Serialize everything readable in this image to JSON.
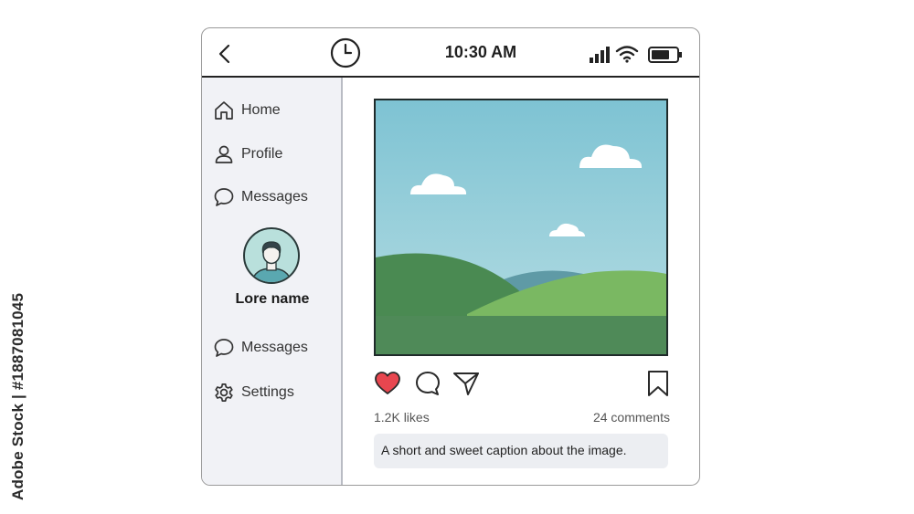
{
  "side_caption": "Adobe Stock | #1887081045",
  "status_bar": {
    "time": "10:30 AM",
    "icons": [
      "back-arrow-icon",
      "clock-icon",
      "signal-icon",
      "wifi-icon",
      "battery-icon"
    ]
  },
  "sidebar": {
    "items_top": [
      {
        "label": "Home",
        "icon": "home-icon"
      },
      {
        "label": "Profile",
        "icon": "user-icon"
      },
      {
        "label": "Messages",
        "icon": "chat-bubble-icon"
      }
    ],
    "profile": {
      "name": "Lore name",
      "avatar": "avatar-icon"
    },
    "items_bottom": [
      {
        "label": "Messages",
        "icon": "chat-bubble-icon"
      },
      {
        "label": "Settings",
        "icon": "gear-icon"
      }
    ]
  },
  "post": {
    "image": "landscape-illustration",
    "likes": "1.2K likes",
    "comments": "24 comments",
    "caption": "A short and sweet caption about the image.",
    "actions": [
      "heart-icon",
      "comment-icon",
      "send-icon",
      "bookmark-icon"
    ],
    "liked": true
  },
  "colors": {
    "heart": "#e8464f",
    "sky": "#8ec9d8",
    "hill_dark": "#4a8a52",
    "hill_light": "#7ab862",
    "ground": "#4f8a58",
    "sidebar_bg": "#f1f2f6"
  }
}
